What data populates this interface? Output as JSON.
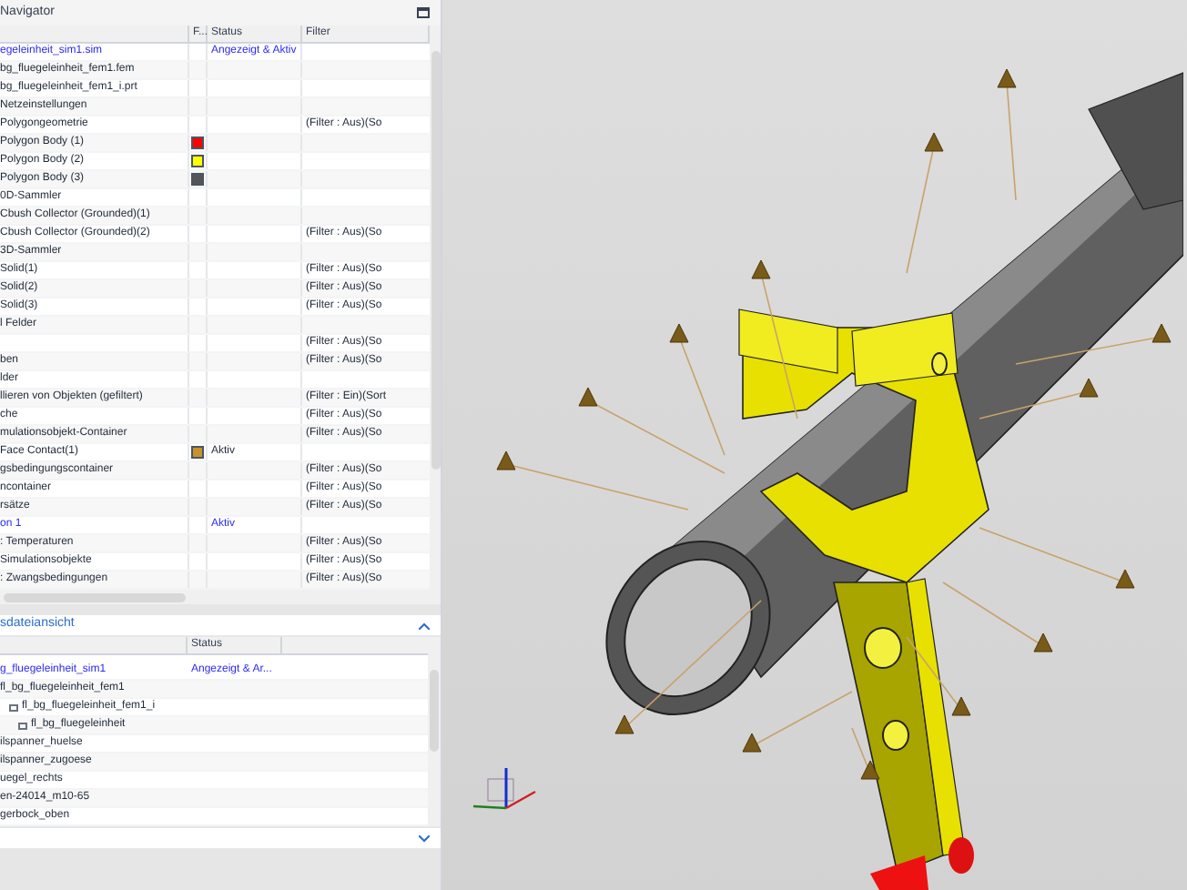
{
  "navigator": {
    "title": "Navigator",
    "columns": [
      "F...",
      "Status",
      "Filter"
    ],
    "rows": [
      {
        "name": "egeleinheit_sim1.sim",
        "status": "Angezeigt & Aktiv",
        "active": true
      },
      {
        "name": "bg_fluegeleinheit_fem1.fem",
        "active": false
      },
      {
        "name": "bg_fluegeleinheit_fem1_i.prt",
        "active": false
      },
      {
        "name": "Netzeinstellungen",
        "active": false
      },
      {
        "name": "Polygongeometrie",
        "filter": "(Filter : Aus)(So",
        "active": false
      },
      {
        "name": "Polygon Body (1)",
        "color": "#ff0000",
        "active": false
      },
      {
        "name": "Polygon Body (2)",
        "color": "#ffff00",
        "active": false
      },
      {
        "name": "Polygon Body (3)",
        "color": "#555555",
        "active": false
      },
      {
        "name": "0D-Sammler",
        "active": false
      },
      {
        "name": "Cbush Collector (Grounded)(1)",
        "active": false
      },
      {
        "name": "Cbush Collector (Grounded)(2)",
        "filter": "(Filter : Aus)(So",
        "active": false
      },
      {
        "name": "3D-Sammler",
        "active": false
      },
      {
        "name": "Solid(1)",
        "filter": "(Filter : Aus)(So",
        "active": false
      },
      {
        "name": "Solid(2)",
        "filter": "(Filter : Aus)(So",
        "active": false
      },
      {
        "name": "Solid(3)",
        "filter": "(Filter : Aus)(So",
        "active": false
      },
      {
        "name": "l Felder",
        "active": false
      },
      {
        "filter": "(Filter : Aus)(So",
        "active": false
      },
      {
        "name": "ben",
        "filter": "(Filter : Aus)(So",
        "active": false
      },
      {
        "name": "lder",
        "active": false
      },
      {
        "name": "llieren von Objekten (gefiltert)",
        "filter": "(Filter : Ein)(Sort",
        "active": false
      },
      {
        "name": "che",
        "filter": "(Filter : Aus)(So",
        "active": false
      },
      {
        "name": "mulationsobjekt-Container",
        "filter": "(Filter : Aus)(So",
        "active": false
      },
      {
        "name": "Face Contact(1)",
        "color": "#c8922a",
        "status": "Aktiv",
        "active": false
      },
      {
        "name": "gsbedingungscontainer",
        "filter": "(Filter : Aus)(So",
        "active": false
      },
      {
        "name": "ncontainer",
        "filter": "(Filter : Aus)(So",
        "active": false
      },
      {
        "name": "rsätze",
        "filter": "(Filter : Aus)(So",
        "active": false
      },
      {
        "name": "on 1",
        "status": "Aktiv",
        "active": true
      },
      {
        "name": ": Temperaturen",
        "filter": "(Filter : Aus)(So",
        "active": false
      },
      {
        "name": "Simulationsobjekte",
        "filter": "(Filter : Aus)(So",
        "active": false
      },
      {
        "name": ": Zwangsbedingungen",
        "filter": "(Filter : Aus)(So",
        "active": false
      }
    ]
  },
  "file_view": {
    "title": "sdateiansicht",
    "columns": [
      "Status"
    ],
    "rows": [
      {
        "name": "g_fluegeleinheit_sim1",
        "status": "Angezeigt & Ar...",
        "active": true
      },
      {
        "name": "fl_bg_fluegeleinheit_fem1",
        "active": false,
        "children": [
          {
            "name": "fl_bg_fluegeleinheit_fem1_i",
            "active": false,
            "children": [
              {
                "name": "fl_bg_fluegeleinheit",
                "active": false
              }
            ]
          }
        ]
      },
      {
        "name": "ilspanner_huelse",
        "active": false
      },
      {
        "name": "ilspanner_zugoese",
        "active": false
      },
      {
        "name": "uegel_rechts",
        "active": false
      },
      {
        "name": "en-24014_m10-65",
        "active": false
      },
      {
        "name": "gerbock_oben",
        "active": false
      }
    ]
  }
}
